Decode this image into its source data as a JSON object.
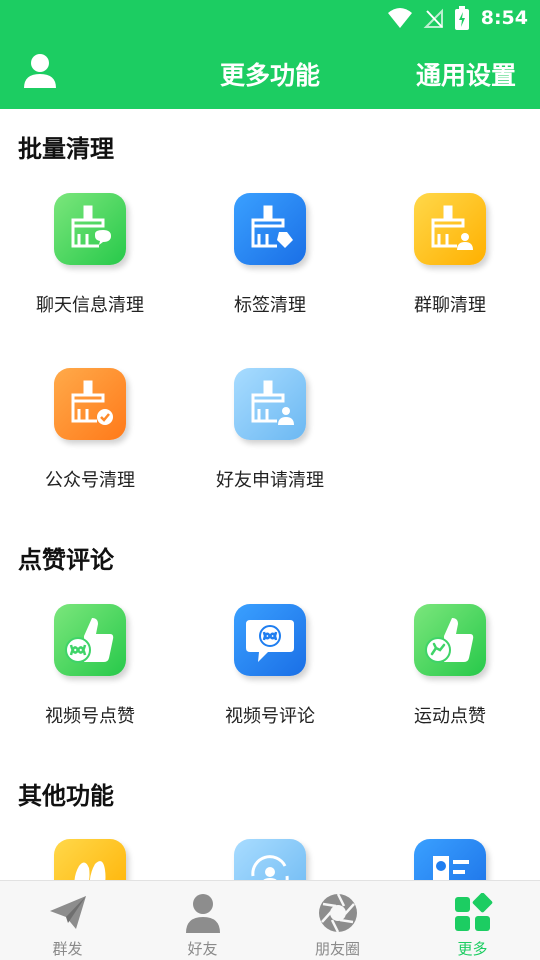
{
  "status_bar": {
    "time": "8:54",
    "wifi_icon": "wifi-icon",
    "signal_icon": "no-signal-icon",
    "battery_icon": "battery-charging-icon"
  },
  "header": {
    "title": "更多功能",
    "settings_label": "通用设置",
    "profile_icon": "user-icon"
  },
  "colors": {
    "brand": "#1ccd62",
    "active_tab": "#1ccd62",
    "inactive_tab": "#8a8a8a"
  },
  "sections": [
    {
      "title": "批量清理",
      "items": [
        {
          "label": "聊天信息清理",
          "icon": "broom-chat-icon",
          "color": "green"
        },
        {
          "label": "标签清理",
          "icon": "broom-tag-icon",
          "color": "blue"
        },
        {
          "label": "群聊清理",
          "icon": "broom-group-icon",
          "color": "yellow"
        },
        {
          "label": "公众号清理",
          "icon": "broom-verified-icon",
          "color": "orange"
        },
        {
          "label": "好友申请清理",
          "icon": "broom-add-friend-icon",
          "color": "lightblue"
        }
      ]
    },
    {
      "title": "点赞评论",
      "items": [
        {
          "label": "视频号点赞",
          "icon": "thumbs-up-channels-icon",
          "color": "green"
        },
        {
          "label": "视频号评论",
          "icon": "comment-channels-icon",
          "color": "blue"
        },
        {
          "label": "运动点赞",
          "icon": "thumbs-up-sport-icon",
          "color": "green"
        }
      ]
    },
    {
      "title": "其他功能",
      "items": [
        {
          "label": "",
          "icon": "contacts-faces-icon",
          "color": "yellow"
        },
        {
          "label": "",
          "icon": "user-refresh-icon",
          "color": "lightblue"
        },
        {
          "label": "",
          "icon": "user-list-icon",
          "color": "blue"
        }
      ]
    }
  ],
  "bottom_nav": [
    {
      "label": "群发",
      "icon": "paper-plane-icon",
      "active": false
    },
    {
      "label": "好友",
      "icon": "person-icon",
      "active": false
    },
    {
      "label": "朋友圈",
      "icon": "aperture-icon",
      "active": false
    },
    {
      "label": "更多",
      "icon": "grid-more-icon",
      "active": true
    }
  ]
}
